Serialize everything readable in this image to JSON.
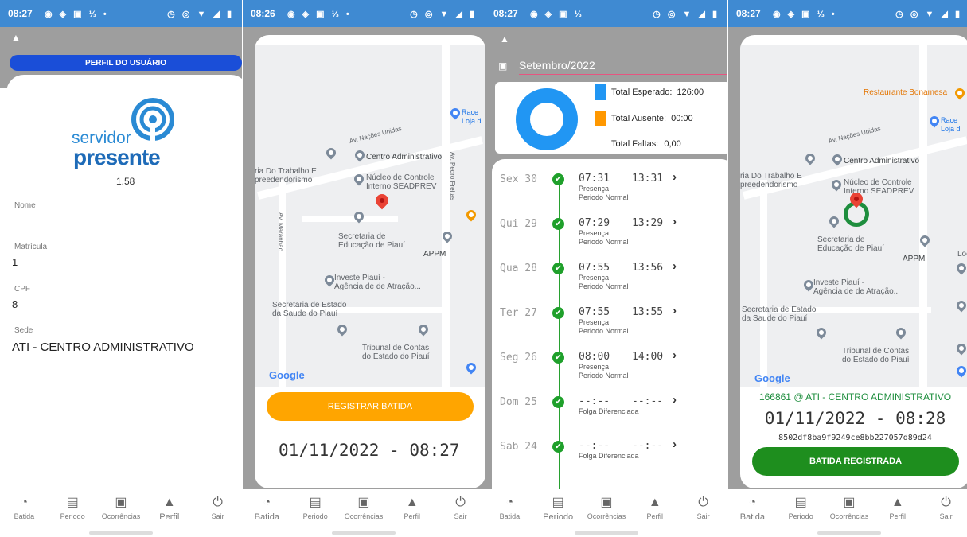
{
  "status_bars": [
    {
      "time": "08:27",
      "icons_left": "◉ ◈ ▣ ⅓ •",
      "icons_right": "◷ ◎ ▼ ◢ ▮"
    },
    {
      "time": "08:26",
      "icons_left": "◉ ◈ ▣ ⅓ •",
      "icons_right": "◷ ◎ ▼ ◢ ▮"
    },
    {
      "time": "08:27",
      "icons_left": "◉ ◈ ▣ ⅓",
      "icons_right": "◷ ◎ ▼ ◢ ▮"
    },
    {
      "time": "08:27",
      "icons_left": "◉ ◈ ▣ ⅓ •",
      "icons_right": "◷ ◎ ▼ ◢ ▮"
    }
  ],
  "bottom_nav": [
    {
      "label": "Batida",
      "icon": "clock-check-icon"
    },
    {
      "label": "Periodo",
      "icon": "table-icon"
    },
    {
      "label": "Ocorrências",
      "icon": "calendar-icon"
    },
    {
      "label": "Perfil",
      "icon": "person-icon"
    },
    {
      "label": "Sair",
      "icon": "power-icon"
    }
  ],
  "profile": {
    "header": "PERFIL DO USUÁRIO",
    "logo_line1": "servidor",
    "logo_line2": "presente",
    "version": "1.58",
    "fields": [
      {
        "label": "Nome",
        "value": ""
      },
      {
        "label": "Matrícula",
        "value": "1"
      },
      {
        "label": "CPF",
        "value": "8"
      },
      {
        "label": "Sede",
        "value": "ATI - CENTRO ADMINISTRATIVO"
      }
    ]
  },
  "map": {
    "labels": {
      "road_nacoes": "Av. Nações Unidas",
      "road_pedro": "Av. Pedro Freitas",
      "road_maranhao": "Av. Maranhão",
      "centro": "Centro Administrativo",
      "trabalho": "ria Do Trabalho E\npreedendorismo",
      "nucleo": "Núcleo de Controle\nInterno SEADPREV",
      "educacao": "Secretaria de\nEducação de Piauí",
      "appm": "APPM",
      "investe": "Investe Piauí -\nAgência de de Atração...",
      "saude": "Secretaria de Estado\nda Saude do Piauí",
      "tribunal": "Tribunal de Contas\ndo Estado do Piauí",
      "race": "Race\nLoja d",
      "bonamesa": "Restaurante Bonamesa",
      "loc": "Loc",
      "google": "Google"
    }
  },
  "register": {
    "button": "REGISTRAR BATIDA",
    "datetime": "01/11/2022 - 08:27"
  },
  "registered": {
    "location": "166861 @ ATI - CENTRO ADMINISTRATIVO",
    "datetime": "01/11/2022 - 08:28",
    "hash": "8502df8ba9f9249ce8bb227057d89d24",
    "button": "BATIDA REGISTRADA"
  },
  "period": {
    "month": "Setembro/2022",
    "legend": [
      {
        "label": "Total Esperado:",
        "value": "126:00",
        "color": "#2196f3"
      },
      {
        "label": "Total Ausente:",
        "value": "00:00",
        "color": "#ff9800"
      }
    ],
    "faltas_label": "Total Faltas:",
    "faltas_value": "0,00",
    "chart_data": {
      "type": "pie",
      "categories": [
        "Total Esperado",
        "Total Ausente"
      ],
      "values": [
        126,
        0
      ]
    },
    "days": [
      {
        "day": "Sex 30",
        "in": "07:31",
        "out": "13:31",
        "s1": "Presença",
        "s2": "Periodo Normal"
      },
      {
        "day": "Qui 29",
        "in": "07:29",
        "out": "13:29",
        "s1": "Presença",
        "s2": "Periodo Normal"
      },
      {
        "day": "Qua 28",
        "in": "07:55",
        "out": "13:56",
        "s1": "Presença",
        "s2": "Periodo Normal"
      },
      {
        "day": "Ter 27",
        "in": "07:55",
        "out": "13:55",
        "s1": "Presença",
        "s2": "Periodo Normal"
      },
      {
        "day": "Seg 26",
        "in": "08:00",
        "out": "14:00",
        "s1": "Presença",
        "s2": "Periodo Normal"
      },
      {
        "day": "Dom 25",
        "in": "--:--",
        "out": "--:--",
        "s1": "Folga Diferenciada",
        "s2": ""
      },
      {
        "day": "Sab 24",
        "in": "--:--",
        "out": "--:--",
        "s1": "Folga Diferenciada",
        "s2": ""
      }
    ]
  }
}
